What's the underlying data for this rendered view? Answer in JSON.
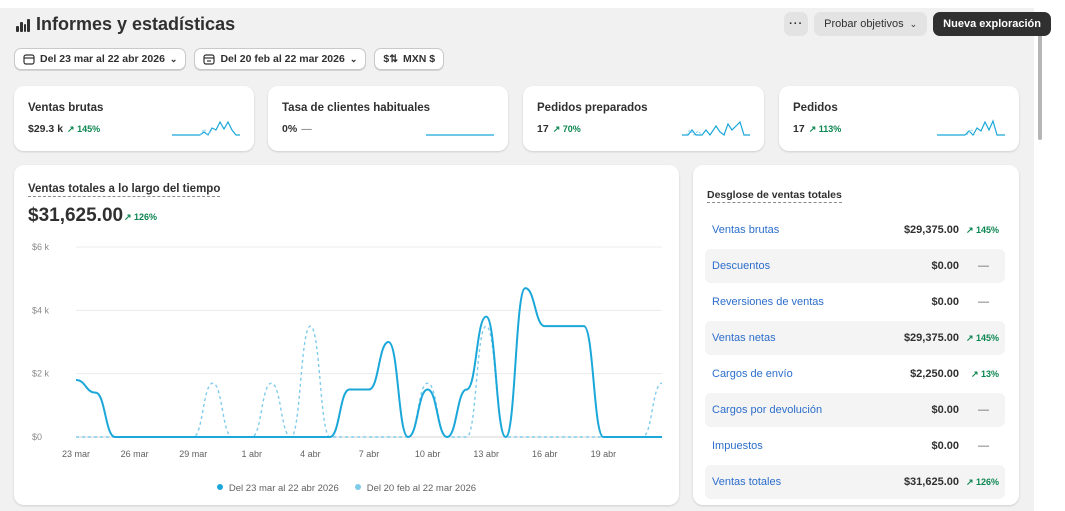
{
  "header": {
    "title": "Informes y estadísticas",
    "more_label": "···",
    "goals_label": "Probar objetivos",
    "new_label": "Nueva exploración"
  },
  "filters": {
    "date_range": "Del 23 mar al 22 abr 2026",
    "compare_range": "Del 20 feb al 22 mar 2026",
    "currency": "MXN $"
  },
  "kpis": [
    {
      "title": "Ventas brutas",
      "value": "$29.3 k",
      "change": "↗ 145%"
    },
    {
      "title": "Tasa de clientes habituales",
      "value": "0%",
      "change": "—"
    },
    {
      "title": "Pedidos preparados",
      "value": "17",
      "change": "↗ 70%"
    },
    {
      "title": "Pedidos",
      "value": "17",
      "change": "↗ 113%"
    }
  ],
  "chart": {
    "title": "Ventas totales a lo largo del tiempo",
    "total": "$31,625.00",
    "total_change": "↗ 126%"
  },
  "chart_data": {
    "type": "line",
    "title": "Ventas totales a lo largo del tiempo",
    "xlabel": "",
    "ylabel": "",
    "ylim": [
      0,
      6000
    ],
    "yticks": [
      "$0",
      "$2 k",
      "$4 k",
      "$6 k"
    ],
    "xticks": [
      "23 mar",
      "26 mar",
      "29 mar",
      "1 abr",
      "4 abr",
      "7 abr",
      "10 abr",
      "13 abr",
      "16 abr",
      "19 abr"
    ],
    "grid": true,
    "legend": "bottom",
    "series": [
      {
        "name": "Del 23 mar al 22 abr 2026",
        "color": "#1ba7d9",
        "style": "solid",
        "values": [
          1800,
          1400,
          0,
          0,
          0,
          0,
          0,
          0,
          0,
          0,
          0,
          0,
          0,
          0,
          1500,
          1500,
          3000,
          0,
          1500,
          0,
          1500,
          3800,
          0,
          4700,
          3500,
          3500,
          3500,
          0,
          0,
          0,
          0
        ]
      },
      {
        "name": "Del 20 feb al 22 mar 2026",
        "color": "#7fcbea",
        "style": "dashed",
        "values": [
          0,
          0,
          0,
          0,
          0,
          0,
          0,
          1700,
          0,
          0,
          1700,
          0,
          3500,
          0,
          0,
          0,
          0,
          0,
          1700,
          0,
          0,
          3500,
          0,
          0,
          0,
          0,
          0,
          0,
          0,
          0,
          1700
        ]
      }
    ]
  },
  "breakdown": {
    "title": "Desglose de ventas totales",
    "rows": [
      {
        "label": "Ventas brutas",
        "value": "$29,375.00",
        "change": "↗ 145%"
      },
      {
        "label": "Descuentos",
        "value": "$0.00",
        "change": "—"
      },
      {
        "label": "Reversiones de ventas",
        "value": "$0.00",
        "change": "—"
      },
      {
        "label": "Ventas netas",
        "value": "$29,375.00",
        "change": "↗ 145%"
      },
      {
        "label": "Cargos de envío",
        "value": "$2,250.00",
        "change": "↗ 13%"
      },
      {
        "label": "Cargos por devolución",
        "value": "$0.00",
        "change": "—"
      },
      {
        "label": "Impuestos",
        "value": "$0.00",
        "change": "—"
      },
      {
        "label": "Ventas totales",
        "value": "$31,625.00",
        "change": "↗ 126%"
      }
    ]
  },
  "colors": {
    "accent": "#1ba7d9",
    "compare": "#7fcbea",
    "positive": "#0c8650",
    "link": "#2c6ecb"
  }
}
